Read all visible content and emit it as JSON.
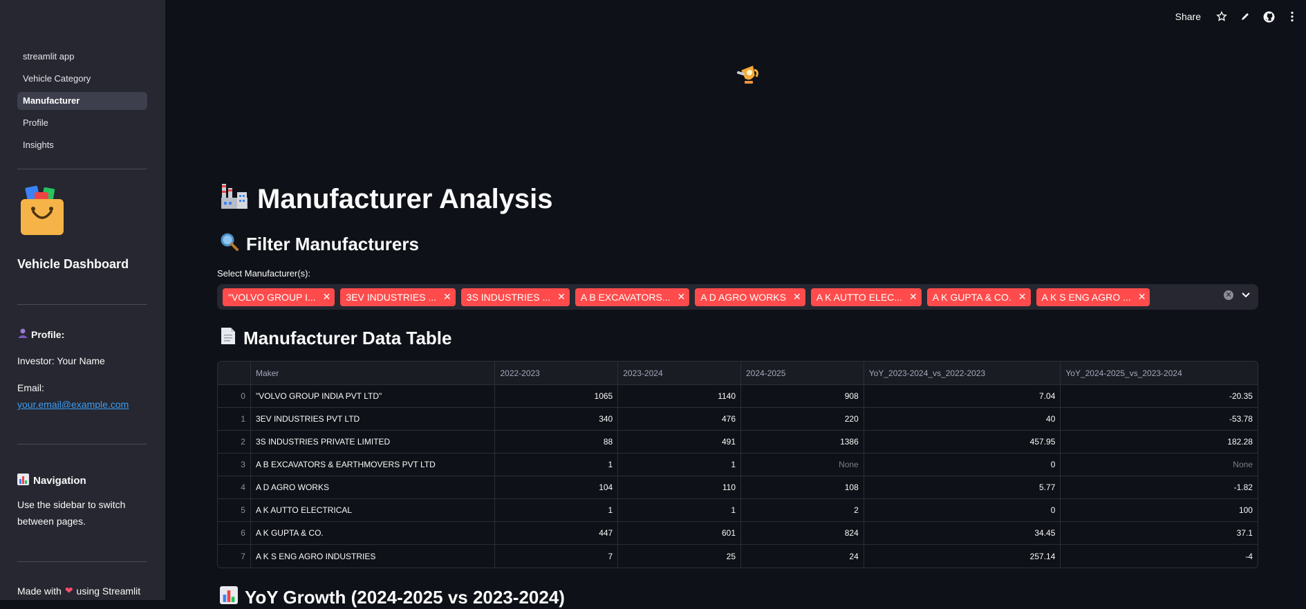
{
  "sidebar": {
    "nav": [
      {
        "label": "streamlit app",
        "active": false
      },
      {
        "label": "Vehicle Category",
        "active": false
      },
      {
        "label": "Manufacturer",
        "active": true
      },
      {
        "label": "Profile",
        "active": false
      },
      {
        "label": "Insights",
        "active": false
      }
    ],
    "title": "Vehicle Dashboard",
    "profile_heading": "Profile:",
    "investor": "Investor: Your Name",
    "email_label": "Email:",
    "email": "your.email@example.com",
    "navigation_heading": "Navigation",
    "navigation_text_1": "Use the sidebar to switch",
    "navigation_text_2": "between pages.",
    "footer_pre": "Made with",
    "footer_post": "using Streamlit"
  },
  "topbar": {
    "share": "Share"
  },
  "main": {
    "title": "Manufacturer Analysis",
    "filter_heading": "Filter Manufacturers",
    "select_label": "Select Manufacturer(s):",
    "tags": [
      "\"VOLVO GROUP I...",
      "3EV INDUSTRIES ...",
      "3S INDUSTRIES ...",
      "A B EXCAVATORS...",
      "A D AGRO WORKS",
      "A K AUTTO ELEC...",
      "A K GUPTA & CO.",
      "A K S ENG AGRO ..."
    ],
    "table_heading": "Manufacturer Data Table",
    "yoy_heading": "YoY Growth (2024-2025 vs 2023-2024)"
  },
  "table": {
    "columns": [
      "",
      "Maker",
      "2022-2023",
      "2023-2024",
      "2024-2025",
      "YoY_2023-2024_vs_2022-2023",
      "YoY_2024-2025_vs_2023-2024"
    ],
    "rows": [
      [
        "0",
        "\"VOLVO GROUP INDIA PVT LTD\"",
        "1065",
        "1140",
        "908",
        "7.04",
        "-20.35"
      ],
      [
        "1",
        "3EV INDUSTRIES PVT LTD",
        "340",
        "476",
        "220",
        "40",
        "-53.78"
      ],
      [
        "2",
        "3S INDUSTRIES PRIVATE LIMITED",
        "88",
        "491",
        "1386",
        "457.95",
        "182.28"
      ],
      [
        "3",
        "A B EXCAVATORS & EARTHMOVERS PVT LTD",
        "1",
        "1",
        "None",
        "0",
        "None"
      ],
      [
        "4",
        "A D AGRO WORKS",
        "104",
        "110",
        "108",
        "5.77",
        "-1.82"
      ],
      [
        "5",
        "A K AUTTO ELECTRICAL",
        "1",
        "1",
        "2",
        "0",
        "100"
      ],
      [
        "6",
        "A K GUPTA & CO.",
        "447",
        "601",
        "824",
        "34.45",
        "37.1"
      ],
      [
        "7",
        "A K S ENG AGRO INDUSTRIES",
        "7",
        "25",
        "24",
        "257.14",
        "-4"
      ]
    ]
  }
}
